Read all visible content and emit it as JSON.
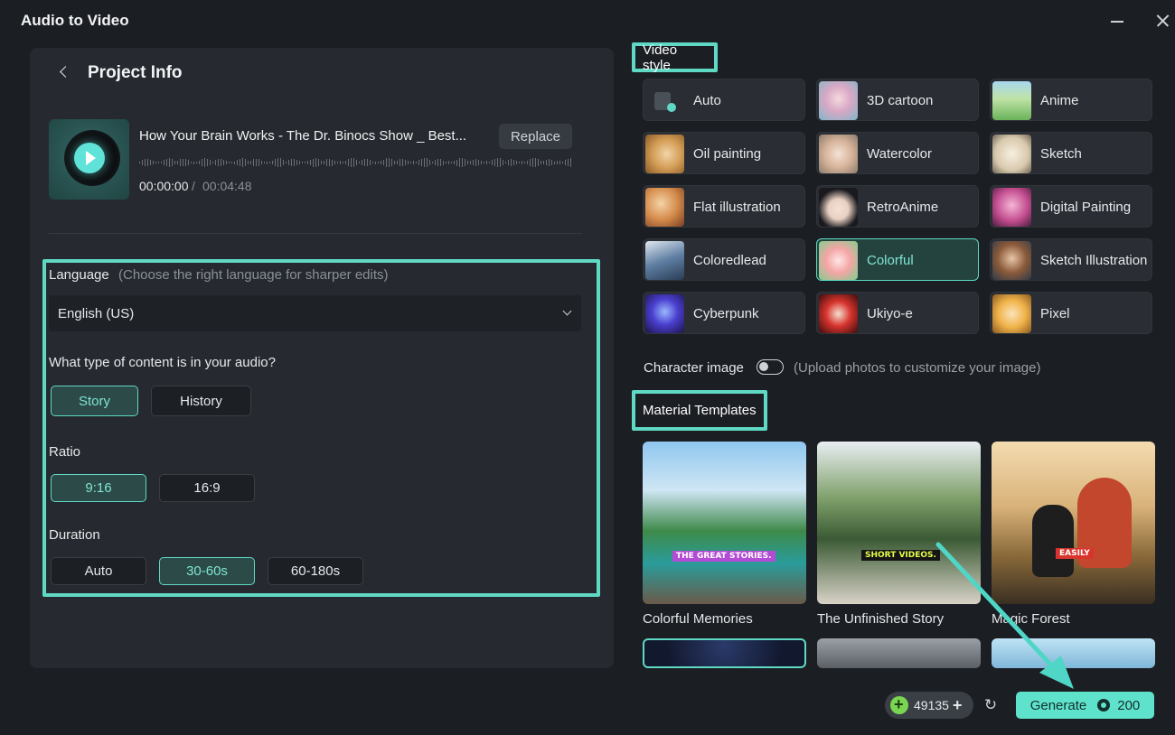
{
  "window": {
    "title": "Audio to Video"
  },
  "project": {
    "title": "Project Info",
    "track_title": "How Your Brain Works  - The Dr. Binocs Show _ Best...",
    "replace_label": "Replace",
    "time_current": "00:00:00",
    "time_separator": "/",
    "time_total": "00:04:48"
  },
  "language": {
    "label": "Language",
    "hint": "(Choose the right language for sharper edits)",
    "value": "English (US)"
  },
  "content_type": {
    "question": "What type of content is in your audio?",
    "options": [
      "Story",
      "History"
    ],
    "selected": "Story"
  },
  "ratio": {
    "label": "Ratio",
    "options": [
      "9:16",
      "16:9"
    ],
    "selected": "9:16"
  },
  "duration": {
    "label": "Duration",
    "options": [
      "Auto",
      "30-60s",
      "60-180s"
    ],
    "selected": "30-60s"
  },
  "video_style": {
    "title": "Video style",
    "items": [
      {
        "label": "Auto"
      },
      {
        "label": "3D cartoon"
      },
      {
        "label": "Anime"
      },
      {
        "label": "Oil painting"
      },
      {
        "label": "Watercolor"
      },
      {
        "label": "Sketch"
      },
      {
        "label": "Flat illustration"
      },
      {
        "label": "RetroAnime"
      },
      {
        "label": "Digital Painting"
      },
      {
        "label": "Coloredlead"
      },
      {
        "label": "Colorful"
      },
      {
        "label": "Sketch Illustration"
      },
      {
        "label": "Cyberpunk"
      },
      {
        "label": "Ukiyo-e"
      },
      {
        "label": "Pixel"
      }
    ],
    "selected": "Colorful"
  },
  "character_image": {
    "label": "Character image",
    "hint": "(Upload photos to customize your image)",
    "enabled": false
  },
  "material_templates": {
    "title": "Material Templates",
    "items": [
      {
        "label": "Colorful Memories",
        "badge": "THE GREAT STORIES."
      },
      {
        "label": "The Unfinished Story",
        "badge": "SHORT VIDEOS."
      },
      {
        "label": "Magic Forest",
        "badge": "EASILY"
      }
    ]
  },
  "footer": {
    "credits": "49135",
    "credits_plus": "+",
    "generate_label": "Generate",
    "generate_cost": "200"
  },
  "colors": {
    "accent": "#5fd9c4",
    "background": "#1b1e23",
    "panel": "#262a30"
  }
}
